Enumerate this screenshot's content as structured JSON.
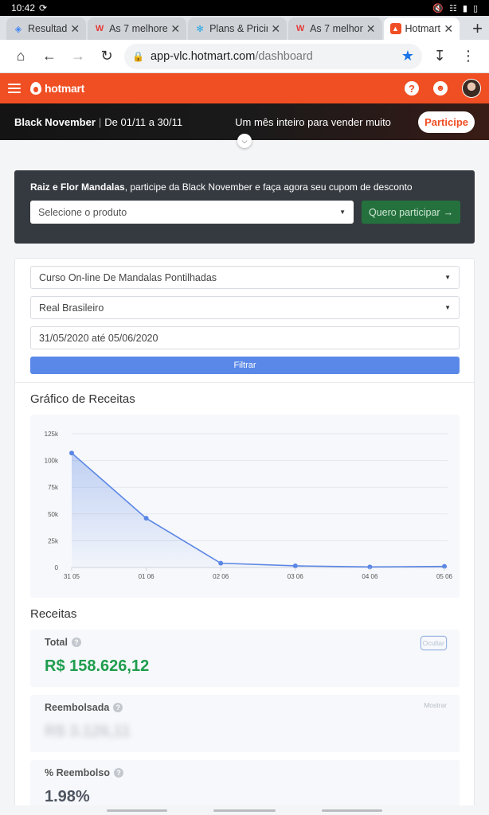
{
  "status_bar": {
    "time": "10:42"
  },
  "tabs": [
    {
      "title": "Resultad",
      "icon_color": "#4285f4",
      "active": false
    },
    {
      "title": "As 7 melhores",
      "icon_color": "#e53935",
      "active": false
    },
    {
      "title": "Plans & Pricing",
      "icon_color": "#26a5e4",
      "active": false
    },
    {
      "title": "As 7 melhor",
      "icon_color": "#e53935",
      "active": false
    },
    {
      "title": "Hotmart",
      "icon_color": "#f04e23",
      "active": true
    }
  ],
  "address_bar": {
    "host": "app-vlc.hotmart.com",
    "path": "/dashboard"
  },
  "header": {
    "logo": "hotmart"
  },
  "banner": {
    "title": "Black November",
    "dates": "De 01/11 a 30/11",
    "tagline": "Um mês inteiro para vender muito",
    "cta": "Participe"
  },
  "promo": {
    "brand": "Raiz e Flor Mandalas",
    "message": ", participe da Black November e faça agora seu cupom de desconto",
    "product_select": "Selecione o produto",
    "cta": "Quero participar"
  },
  "filters": {
    "product": "Curso On-line De Mandalas Pontilhadas",
    "currency": "Real Brasileiro",
    "date_range": "31/05/2020 até 05/06/2020",
    "submit": "Filtrar"
  },
  "chart_title": "Gráfico de Receitas",
  "chart_data": {
    "type": "area",
    "categories": [
      "31 05",
      "01 06",
      "02 06",
      "03 06",
      "04 06",
      "05 06"
    ],
    "values": [
      107000,
      46000,
      4000,
      1500,
      500,
      1000
    ],
    "y_ticks": [
      "0",
      "25k",
      "50k",
      "75k",
      "100k",
      "125k"
    ],
    "ylim": [
      0,
      125000
    ],
    "grid": true,
    "line_color": "#5b86e5"
  },
  "revenue": {
    "title": "Receitas",
    "total": {
      "label": "Total",
      "value": "R$ 158.626,12",
      "toggle": "Ocultar"
    },
    "refunded": {
      "label": "Reembolsada",
      "value": "R$ 3.126,11",
      "toggle": "Mostrar"
    },
    "refund_pct": {
      "label": "% Reembolso",
      "value": "1.98%"
    }
  }
}
